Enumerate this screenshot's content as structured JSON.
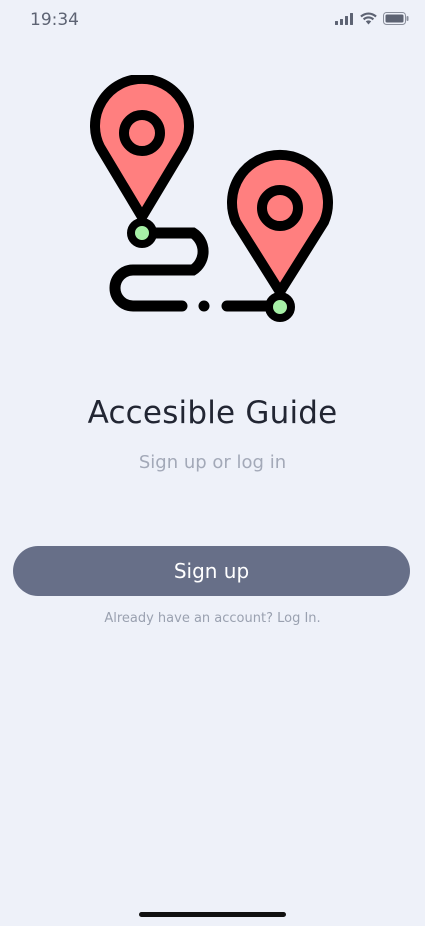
{
  "status_bar": {
    "time": "19:34",
    "icons": [
      "cellular-signal-icon",
      "wifi-icon",
      "battery-icon"
    ]
  },
  "illustration": {
    "icon": "route-map-pins-icon",
    "colors": {
      "pin_fill": "#ff7f7f",
      "outline": "#000000",
      "dot": "#a6f0a6"
    }
  },
  "app": {
    "title": "Accesible Guide",
    "subtitle": "Sign up or log in"
  },
  "actions": {
    "signup_label": "Sign up",
    "login_text": "Already have an account? Log In."
  },
  "colors": {
    "background": "#eef1f9",
    "button": "#676f88",
    "title": "#222633",
    "muted": "#a3a9b8"
  }
}
